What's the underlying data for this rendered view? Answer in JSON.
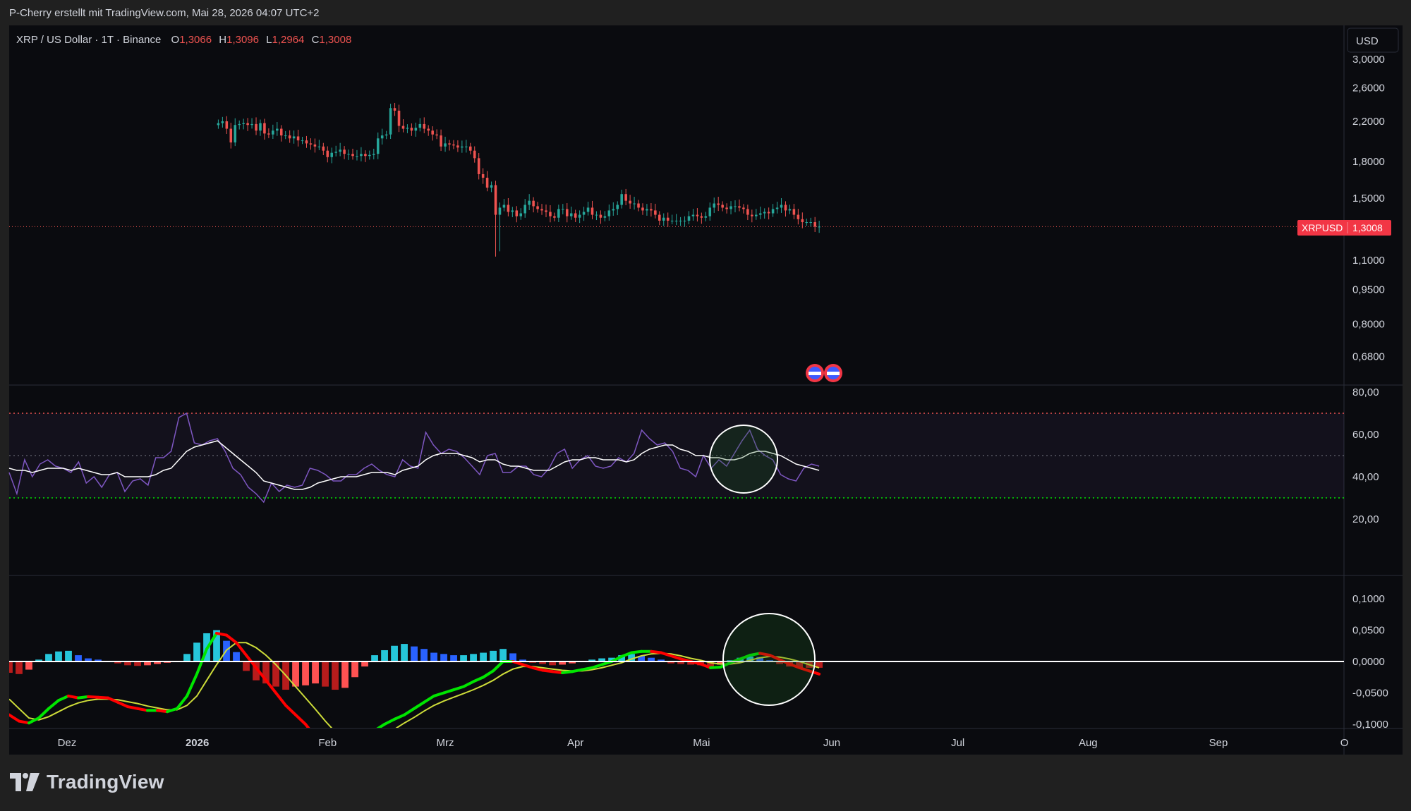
{
  "header": {
    "attribution": "P-Cherry erstellt mit TradingView.com, Mai 28, 2026 04:07 UTC+2"
  },
  "legend": {
    "symbol": "XRP / US Dollar · 1T · Binance",
    "open_label": "O",
    "open": "1,3066",
    "high_label": "H",
    "high": "1,3096",
    "low_label": "L",
    "low": "1,2964",
    "close_label": "C",
    "close": "1,3008"
  },
  "currency_button": "USD",
  "price_badge": {
    "symbol": "XRPUSD",
    "value": "1,3008"
  },
  "brand": {
    "name": "TradingView"
  },
  "colors": {
    "background": "#0a0b0f",
    "up": "#26a69a",
    "down": "#ef5350",
    "badge": "#f23645",
    "rsi_line": "#7e57c2",
    "rsi_ma": "#ffffff",
    "macd_up": "#00e600",
    "macd_down": "#ff0000",
    "signal": "#cddc39"
  },
  "chart_data": [
    {
      "type": "candlestick",
      "name": "XRP / US Dollar",
      "scale": "log",
      "y_ticks": [
        "3,0000",
        "2,6000",
        "2,2000",
        "1,8000",
        "1,5000",
        "1,1000",
        "0,9500",
        "0,8000",
        "0,6800"
      ],
      "y_tick_values": [
        3.0,
        2.6,
        2.2,
        1.8,
        1.5,
        1.1,
        0.95,
        0.8,
        0.68
      ],
      "x_ticks": [
        "Dez",
        "2026",
        "Feb",
        "Mrz",
        "Apr",
        "Mai",
        "Jun",
        "Jul",
        "Aug",
        "Sep",
        "O"
      ],
      "x_tick_days": [
        0,
        31,
        62,
        90,
        121,
        151,
        182,
        212,
        243,
        274,
        304
      ],
      "last_close": 1.3008,
      "closes": [
        2.18,
        2.2,
        2.12,
        1.98,
        2.16,
        2.17,
        2.18,
        2.16,
        2.17,
        2.1,
        2.18,
        2.07,
        2.06,
        2.1,
        2.12,
        2.05,
        2.05,
        2.02,
        2.04,
        2.0,
        2.0,
        1.97,
        1.96,
        1.94,
        1.94,
        1.9,
        1.84,
        1.88,
        1.89,
        1.91,
        1.87,
        1.87,
        1.85,
        1.85,
        1.87,
        1.85,
        1.86,
        1.87,
        2.02,
        2.05,
        2.06,
        2.35,
        2.32,
        2.15,
        2.12,
        2.13,
        2.1,
        2.13,
        2.17,
        2.12,
        2.1,
        2.06,
        2.05,
        1.94,
        1.97,
        1.96,
        1.95,
        1.93,
        1.94,
        1.94,
        1.9,
        1.83,
        1.69,
        1.66,
        1.58,
        1.6,
        1.38,
        1.43,
        1.45,
        1.4,
        1.41,
        1.37,
        1.39,
        1.45,
        1.48,
        1.44,
        1.42,
        1.41,
        1.4,
        1.37,
        1.36,
        1.42,
        1.42,
        1.37,
        1.39,
        1.36,
        1.38,
        1.4,
        1.43,
        1.38,
        1.38,
        1.36,
        1.37,
        1.41,
        1.42,
        1.45,
        1.53,
        1.48,
        1.46,
        1.46,
        1.43,
        1.41,
        1.42,
        1.41,
        1.38,
        1.34,
        1.36,
        1.34,
        1.34,
        1.34,
        1.34,
        1.34,
        1.37,
        1.38,
        1.37,
        1.36,
        1.37,
        1.43,
        1.46,
        1.45,
        1.43,
        1.42,
        1.44,
        1.44,
        1.43,
        1.42,
        1.38,
        1.37,
        1.38,
        1.39,
        1.4,
        1.39,
        1.42,
        1.43,
        1.45,
        1.41,
        1.42,
        1.38,
        1.35,
        1.33,
        1.33,
        1.33,
        1.3,
        1.3008
      ],
      "mark_icon": "us-flag-icon"
    },
    {
      "type": "line",
      "name": "RSI",
      "y_ticks": [
        "80,00",
        "60,00",
        "40,00",
        "20,00"
      ],
      "y_tick_values": [
        80,
        60,
        40,
        20
      ],
      "levels": [
        70,
        50,
        30
      ],
      "rsi": [
        42,
        32,
        48,
        40,
        46,
        48,
        45,
        44,
        42,
        47,
        37,
        40,
        35,
        41,
        42,
        33,
        38,
        39,
        36,
        49,
        49,
        52,
        68,
        70,
        56,
        55,
        57,
        58,
        52,
        44,
        41,
        35,
        32,
        28,
        37,
        33,
        36,
        35,
        36,
        44,
        43,
        41,
        38,
        38,
        41,
        41,
        44,
        46,
        43,
        41,
        40,
        48,
        45,
        44,
        61,
        55,
        51,
        53,
        52,
        49,
        45,
        41,
        50,
        51,
        42,
        42,
        45,
        45,
        41,
        40,
        44,
        51,
        53,
        44,
        48,
        50,
        45,
        44,
        45,
        49,
        47,
        51,
        62,
        58,
        55,
        56,
        52,
        44,
        43,
        40,
        50,
        44,
        48,
        45,
        51,
        57,
        62,
        53,
        50,
        48,
        41,
        39,
        38,
        44,
        46,
        45
      ],
      "rsi_ma": [
        44,
        43,
        43,
        42,
        43,
        44,
        44,
        44,
        43,
        44,
        43,
        42,
        41,
        41,
        42,
        40,
        40,
        40,
        40,
        41,
        43,
        44,
        48,
        52,
        54,
        55,
        56,
        57,
        54,
        51,
        48,
        45,
        42,
        38,
        37,
        36,
        35,
        34,
        34,
        35,
        37,
        38,
        39,
        40,
        40,
        40,
        41,
        42,
        42,
        42,
        41,
        43,
        44,
        45,
        48,
        50,
        51,
        51,
        51,
        50,
        49,
        47,
        48,
        48,
        46,
        45,
        45,
        44,
        43,
        43,
        43,
        45,
        47,
        48,
        48,
        49,
        49,
        48,
        48,
        48,
        47,
        48,
        51,
        53,
        54,
        55,
        55,
        53,
        52,
        50,
        50,
        49,
        49,
        48,
        48,
        49,
        51,
        52,
        52,
        51,
        50,
        48,
        46,
        45,
        44,
        43
      ],
      "highlight": "circle"
    },
    {
      "type": "bar",
      "name": "MACD",
      "y_ticks": [
        "0,1000",
        "0,0500",
        "0,0000",
        "-0,0500",
        "-0,1000"
      ],
      "y_tick_values": [
        0.1,
        0.05,
        0.0,
        -0.05,
        -0.1
      ],
      "macd": [
        -0.085,
        -0.095,
        -0.098,
        -0.09,
        -0.075,
        -0.062,
        -0.055,
        -0.058,
        -0.056,
        -0.057,
        -0.058,
        -0.065,
        -0.072,
        -0.075,
        -0.078,
        -0.078,
        -0.08,
        -0.075,
        -0.055,
        -0.02,
        0.02,
        0.045,
        0.042,
        0.03,
        0.01,
        -0.01,
        -0.03,
        -0.05,
        -0.07,
        -0.085,
        -0.1,
        -0.12,
        -0.14,
        -0.16,
        -0.17,
        -0.15,
        -0.13,
        -0.11,
        -0.1,
        -0.092,
        -0.085,
        -0.075,
        -0.065,
        -0.055,
        -0.05,
        -0.045,
        -0.04,
        -0.032,
        -0.025,
        -0.015,
        0.0,
        0.0,
        -0.005,
        -0.01,
        -0.014,
        -0.016,
        -0.018,
        -0.016,
        -0.013,
        -0.01,
        -0.005,
        0.0,
        0.008,
        0.014,
        0.016,
        0.016,
        0.014,
        0.009,
        0.004,
        0.0,
        -0.004,
        -0.01,
        -0.009,
        -0.002,
        0.004,
        0.01,
        0.013,
        0.01,
        0.003,
        -0.004,
        -0.01,
        -0.015,
        -0.02
      ],
      "signal": [
        -0.06,
        -0.075,
        -0.09,
        -0.093,
        -0.088,
        -0.08,
        -0.072,
        -0.066,
        -0.062,
        -0.06,
        -0.06,
        -0.061,
        -0.064,
        -0.067,
        -0.071,
        -0.074,
        -0.077,
        -0.077,
        -0.07,
        -0.055,
        -0.03,
        -0.005,
        0.018,
        0.03,
        0.03,
        0.022,
        0.01,
        -0.005,
        -0.022,
        -0.04,
        -0.058,
        -0.076,
        -0.095,
        -0.112,
        -0.128,
        -0.135,
        -0.135,
        -0.128,
        -0.118,
        -0.108,
        -0.098,
        -0.089,
        -0.079,
        -0.07,
        -0.063,
        -0.057,
        -0.051,
        -0.045,
        -0.038,
        -0.03,
        -0.02,
        -0.012,
        -0.008,
        -0.008,
        -0.01,
        -0.012,
        -0.014,
        -0.015,
        -0.015,
        -0.013,
        -0.01,
        -0.006,
        -0.002,
        0.004,
        0.009,
        0.012,
        0.013,
        0.012,
        0.009,
        0.005,
        0.002,
        -0.002,
        -0.004,
        -0.004,
        -0.002,
        0.002,
        0.006,
        0.008,
        0.007,
        0.004,
        0.0,
        -0.005,
        -0.01
      ],
      "histogram": [
        -0.018,
        -0.02,
        -0.013,
        0.003,
        0.012,
        0.016,
        0.017,
        0.01,
        0.005,
        0.003,
        0.001,
        -0.003,
        -0.006,
        -0.007,
        -0.006,
        -0.004,
        -0.002,
        0.001,
        0.012,
        0.03,
        0.045,
        0.05,
        0.033,
        0.015,
        -0.015,
        -0.03,
        -0.035,
        -0.04,
        -0.045,
        -0.04,
        -0.038,
        -0.035,
        -0.04,
        -0.045,
        -0.042,
        -0.025,
        -0.008,
        0.01,
        0.018,
        0.025,
        0.028,
        0.024,
        0.02,
        0.014,
        0.012,
        0.01,
        0.01,
        0.012,
        0.014,
        0.017,
        0.02,
        0.013,
        0.003,
        -0.002,
        -0.004,
        -0.006,
        -0.005,
        -0.003,
        -0.001,
        0.003,
        0.005,
        0.006,
        0.01,
        0.012,
        0.009,
        0.006,
        0.003,
        -0.003,
        -0.004,
        -0.005,
        -0.006,
        -0.008,
        -0.005,
        0.002,
        0.006,
        0.008,
        0.007,
        0.002,
        -0.004,
        -0.008,
        -0.01,
        -0.01,
        -0.01
      ],
      "highlight": "circle"
    }
  ]
}
